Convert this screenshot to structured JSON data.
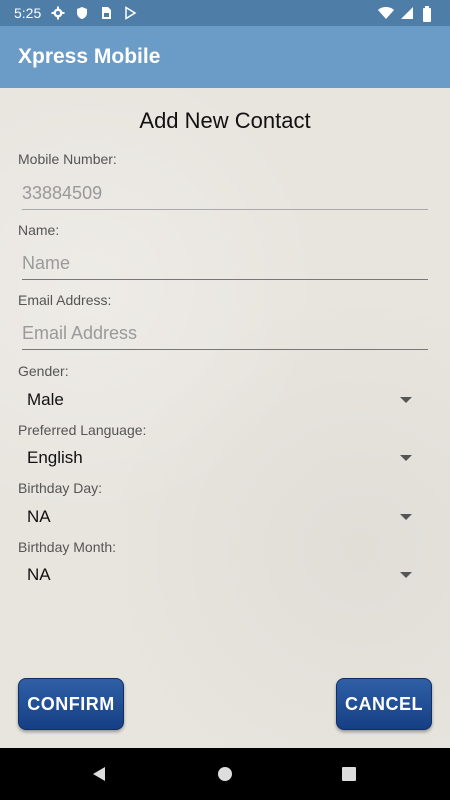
{
  "status_bar": {
    "time": "5:25",
    "left_icons": [
      "gear-icon",
      "shield-icon",
      "sim-card-icon",
      "play-store-icon"
    ],
    "right_icons": [
      "wifi-icon",
      "signal-icon",
      "battery-icon"
    ]
  },
  "app_bar": {
    "title": "Xpress Mobile"
  },
  "form": {
    "title": "Add New Contact",
    "mobile": {
      "label": "Mobile Number:",
      "value": "33884509"
    },
    "name": {
      "label": "Name:",
      "placeholder": "Name"
    },
    "email": {
      "label": "Email Address:",
      "placeholder": "Email Address"
    },
    "gender": {
      "label": "Gender:",
      "value": "Male"
    },
    "language": {
      "label": "Preferred Language:",
      "value": "English"
    },
    "birthday_day": {
      "label": "Birthday Day:",
      "value": "NA"
    },
    "birthday_month": {
      "label": "Birthday Month:",
      "value": "NA"
    }
  },
  "buttons": {
    "confirm": "CONFIRM",
    "cancel": "CANCEL"
  },
  "colors": {
    "status_bar": "#4e7ea8",
    "app_bar": "#6b9cc7",
    "button": "#1f4e96",
    "background": "#e8e5df"
  }
}
